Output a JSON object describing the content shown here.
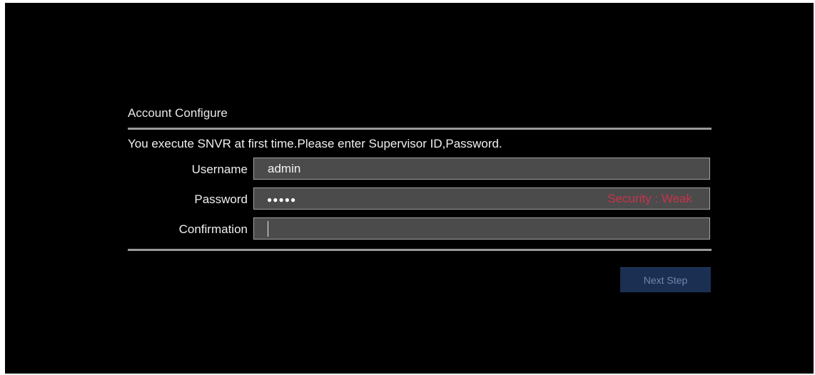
{
  "dialog": {
    "title": "Account Configure",
    "message": "You execute SNVR at first time.Please enter Supervisor ID,Password."
  },
  "form": {
    "username": {
      "label": "Username",
      "value": "admin"
    },
    "password": {
      "label": "Password",
      "masked_value": "●●●●●",
      "security_text": "Security : Weak",
      "security_color": "#c7334b"
    },
    "confirmation": {
      "label": "Confirmation",
      "value": ""
    }
  },
  "actions": {
    "next_step_label": "Next Step",
    "button_color": "#1a2f52"
  }
}
